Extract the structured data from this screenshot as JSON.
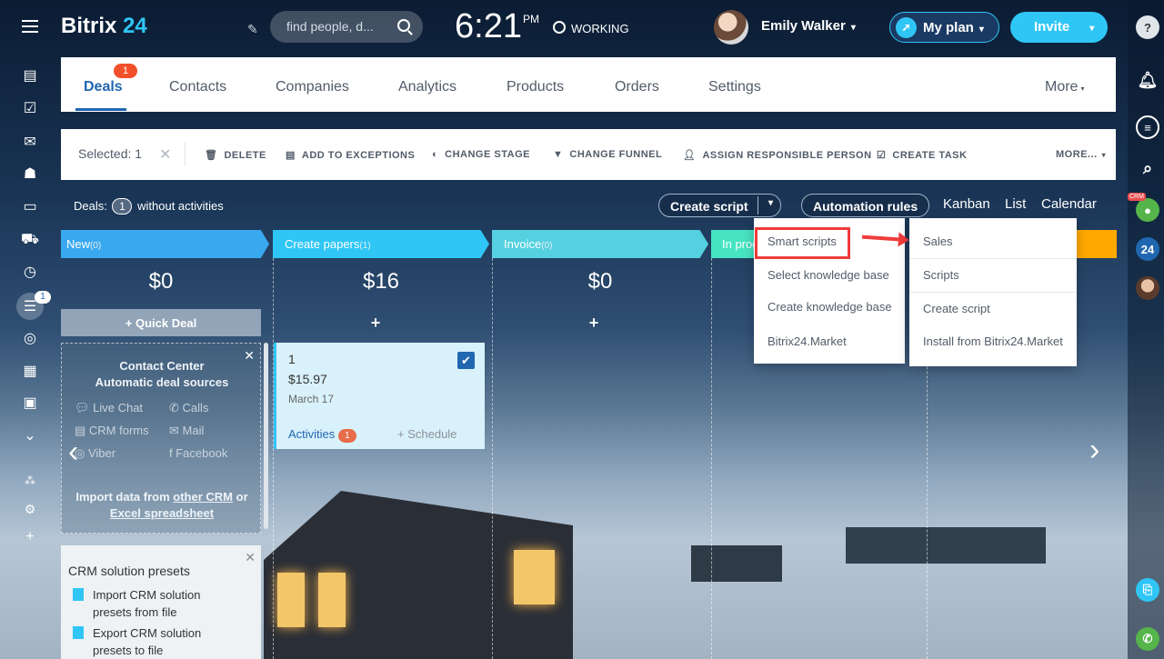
{
  "header": {
    "logo_main": "Bitrix",
    "logo_num": "24",
    "search_placeholder": "find people, d...",
    "time": "6:21",
    "ampm": "PM",
    "status": "WORKING",
    "user_name": "Emily Walker",
    "plan_label": "My plan",
    "invite_label": "Invite"
  },
  "tabs": {
    "deals": "Deals",
    "deals_badge": "1",
    "contacts": "Contacts",
    "companies": "Companies",
    "analytics": "Analytics",
    "products": "Products",
    "orders": "Orders",
    "settings": "Settings",
    "more": "More"
  },
  "actions": {
    "selected": "Selected: 1",
    "delete": "DELETE",
    "exceptions": "ADD TO EXCEPTIONS",
    "change_stage": "CHANGE STAGE",
    "change_funnel": "CHANGE FUNNEL",
    "assign": "ASSIGN RESPONSIBLE PERSON",
    "create_task": "CREATE TASK",
    "more": "MORE..."
  },
  "toolbar": {
    "deals_label": "Deals:",
    "deals_count": "1",
    "without": "without activities",
    "create_script": "Create script",
    "automation": "Automation rules",
    "kanban": "Kanban",
    "list": "List",
    "calendar": "Calendar"
  },
  "stages": [
    {
      "name": "New",
      "count": "(0)",
      "sum": "$0"
    },
    {
      "name": "Create papers",
      "count": "(1)",
      "sum": "$16"
    },
    {
      "name": "Invoice",
      "count": "(0)",
      "sum": "$0"
    },
    {
      "name": "In prog"
    }
  ],
  "quick_deal": "+ Quick Deal",
  "contact_center": {
    "title1": "Contact Center",
    "title2": "Automatic deal sources",
    "live_chat": "Live Chat",
    "calls": "Calls",
    "crm_forms": "CRM forms",
    "mail": "Mail",
    "viber": "Viber",
    "facebook": "Facebook",
    "import1": "Import data from",
    "other_crm": "other CRM",
    "or": "or",
    "excel": "Excel spreadsheet"
  },
  "card": {
    "title": "1",
    "amount": "$15.97",
    "date": "March 17",
    "activities": "Activities",
    "activities_count": "1",
    "schedule": "+ Schedule"
  },
  "presets": {
    "title": "CRM solution presets",
    "import1": "Import CRM solution",
    "import2": "presets from file",
    "export1": "Export CRM solution",
    "export2": "presets to file"
  },
  "menu1": [
    "Smart scripts",
    "Select knowledge base",
    "Create knowledge base",
    "Bitrix24.Market"
  ],
  "menu2": [
    "Sales",
    "Scripts",
    "Create script",
    "Install from Bitrix24.Market"
  ],
  "sidebar": {
    "filter_badge": "1"
  },
  "right_bar": {
    "help": "?",
    "crm_tag": "CRM",
    "b24": "24"
  }
}
